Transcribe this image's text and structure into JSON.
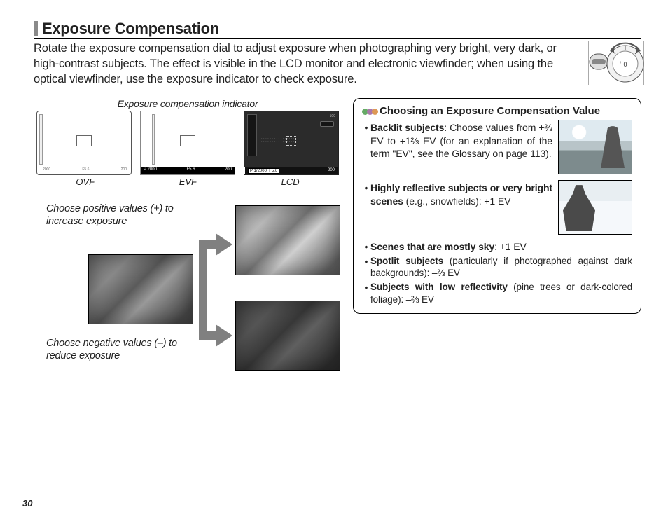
{
  "page_number": "30",
  "title": "Exposure Compensation",
  "intro": "Rotate the exposure compensation dial to adjust exposure when photographing very bright, very dark, or high-contrast subjects. The effect is visible in the LCD monitor and electronic viewfinder; when using the optical viewfinder, use the exposure indicator to check exposure.",
  "indicator_caption": "Exposure compensation indicator",
  "display_labels": {
    "ovf": "OVF",
    "evf": "EVF",
    "lcd": "LCD"
  },
  "ovf_status_left": "2000",
  "ovf_status_mid": "F5.6",
  "ovf_status_right": "200",
  "evf_status_left": "P   2000",
  "evf_status_mid": "F5.6",
  "evf_status_right": "200",
  "lcd_status_1": "P 1/2000",
  "lcd_status_2": "F5.6",
  "lcd_status_right": "200",
  "lcd_top_right": "100",
  "hint_positive": "Choose positive values (+) to increase exposure",
  "hint_negative": "Choose negative values (–) to reduce exposure",
  "tip": {
    "title": "Choosing an Exposure Compensation Value",
    "backlit_label": "Backlit subjects",
    "backlit_text": ": Choose values from +⅔ EV to +1⅔ EV (for an explanation of the term \"EV\", see the Glossary on page 113).",
    "reflective_label": "Highly reflective subjects or very bright scenes",
    "reflective_text": " (e.g., snowfields): +1 EV",
    "sky_label": "Scenes that are mostly sky",
    "sky_text": ": +1 EV",
    "spotlit_label": "Spotlit subjects",
    "spotlit_text": " (particularly if photographed against dark backgrounds): –⅔ EV",
    "lowrefl_label": "Subjects with low reflectivity",
    "lowrefl_text": " (pine trees or dark-colored foliage): –⅔ EV"
  }
}
